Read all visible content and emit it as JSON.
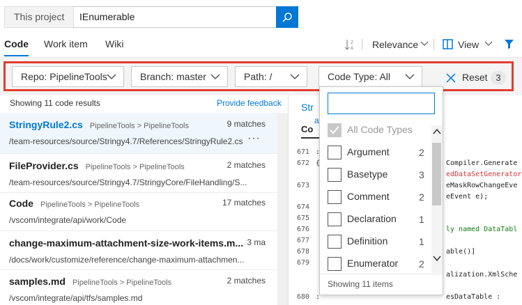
{
  "search": {
    "scope_label": "This project",
    "query": "IEnumerable"
  },
  "tabs": [
    {
      "label": "Code",
      "active": true
    },
    {
      "label": "Work item",
      "active": false
    },
    {
      "label": "Wiki",
      "active": false
    }
  ],
  "toolbar": {
    "sort_label": "Relevance",
    "view_label": "View"
  },
  "filters": {
    "repo": "Repo: PipelineTools",
    "branch": "Branch: master",
    "path": "Path: /",
    "code_type": "Code Type: All",
    "reset_label": "Reset",
    "reset_count": "3"
  },
  "results": {
    "summary": "Showing 11 code results",
    "feedback": "Provide feedback",
    "items": [
      {
        "name": "StringyRule2.cs",
        "project": "PipelineTools > PipelineTools",
        "matches": "9 matches",
        "path": "/team-resources/source/Stringy4.7/References/StringyRule2.cs",
        "more": "···"
      },
      {
        "name": "FileProvider.cs",
        "project": "PipelineTools > PipelineTools",
        "matches": "2 matches",
        "path": "/team-resources/source/Stringy4.7/StringyCore/FileHandling/S..."
      },
      {
        "name": "Code",
        "project": "PipelineTools > PipelineTools",
        "matches": "17 matches",
        "path": "/vscom/integrate/api/work/Code"
      },
      {
        "name": "change-maximum-attachment-size-work-items.m...",
        "project": "",
        "matches": "3 ma",
        "path": "/docs/work/customize/reference/change-maximum-attachmen..."
      },
      {
        "name": "samples.md",
        "project": "PipelineTools > PipelineTools",
        "matches": "2 matches",
        "path": "/vscom/integrate/api/tfs/samples.md"
      }
    ]
  },
  "preview": {
    "tab1": "Str",
    "tab1b": "a",
    "tab2": "Co",
    "line_numbers": [
      "671",
      "672",
      "673",
      "674",
      "675",
      "676",
      "677",
      "678",
      "679",
      "680"
    ],
    "markers": [
      ":",
      "{",
      "",
      "",
      "",
      "",
      "",
      "",
      "",
      ":"
    ],
    "code_lines": [
      {
        "text": "Compiler.Generate",
        "color": "#222222"
      },
      {
        "text": "edDataSetGenerator",
        "color": "#d13438"
      },
      {
        "text": "eMaskRowChangeEve",
        "color": "#222222"
      },
      {
        "text": "eEvent e);",
        "color": "#222222"
      },
      {
        "text": "ly named DataTabl",
        "color": "#107c10"
      },
      {
        "text": "able()]",
        "color": "#222222"
      },
      {
        "text": "alization.XmlSche",
        "color": "#222222"
      },
      {
        "text": "esDataTable :",
        "color": "#222222"
      }
    ]
  },
  "code_type_popup": {
    "search_value": "",
    "items": [
      {
        "label": "All Code Types",
        "count": "",
        "checked": true,
        "disabled": true
      },
      {
        "label": "Argument",
        "count": "2",
        "checked": false
      },
      {
        "label": "Basetype",
        "count": "3",
        "checked": false
      },
      {
        "label": "Comment",
        "count": "2",
        "checked": false
      },
      {
        "label": "Declaration",
        "count": "1",
        "checked": false
      },
      {
        "label": "Definition",
        "count": "1",
        "checked": false
      },
      {
        "label": "Enumerator",
        "count": "2",
        "checked": false
      }
    ],
    "footer": "Showing 11 items"
  },
  "colors": {
    "accent": "#0078d4",
    "highlight_border": "#e33c2e"
  }
}
